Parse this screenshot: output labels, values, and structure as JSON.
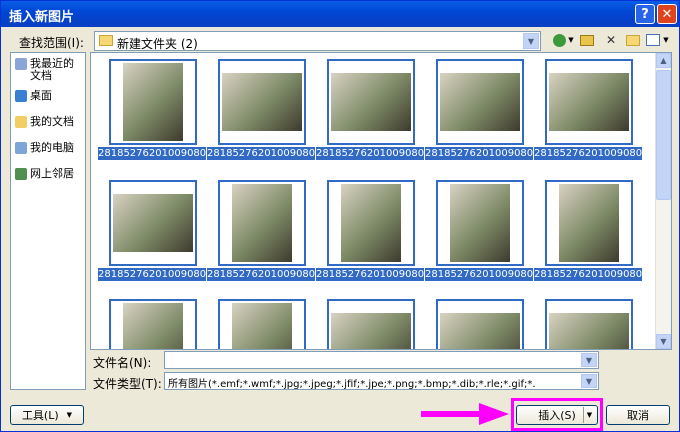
{
  "window": {
    "title": "插入新图片"
  },
  "lookin": {
    "label": "查找范围(I):",
    "value": "新建文件夹 (2)"
  },
  "places": [
    {
      "label": "我最近的文档",
      "icon": "recent-documents-icon"
    },
    {
      "label": "桌面",
      "icon": "desktop-icon"
    },
    {
      "label": "我的文档",
      "icon": "my-documents-icon"
    },
    {
      "label": "我的电脑",
      "icon": "my-computer-icon"
    },
    {
      "label": "网上邻居",
      "icon": "network-places-icon"
    }
  ],
  "files": [
    {
      "name": "28185276201009080..."
    },
    {
      "name": "28185276201009080..."
    },
    {
      "name": "28185276201009080..."
    },
    {
      "name": "28185276201009080..."
    },
    {
      "name": "28185276201009080..."
    },
    {
      "name": "28185276201009080..."
    },
    {
      "name": "28185276201009080..."
    },
    {
      "name": "28185276201009080..."
    },
    {
      "name": "28185276201009080..."
    },
    {
      "name": "28185276201009080..."
    }
  ],
  "filename": {
    "label": "文件名(N):",
    "value": ""
  },
  "filetype": {
    "label": "文件类型(T):",
    "value": "所有图片(*.emf;*.wmf;*.jpg;*.jpeg;*.jfif;*.jpe;*.png;*.bmp;*.dib;*.rle;*.gif;*."
  },
  "buttons": {
    "tools": "工具(L)",
    "insert": "插入(S)",
    "cancel": "取消"
  },
  "colors": {
    "highlight": "#316ac5",
    "annotation": "#ff00ff",
    "title_bar": "#0046d5"
  }
}
